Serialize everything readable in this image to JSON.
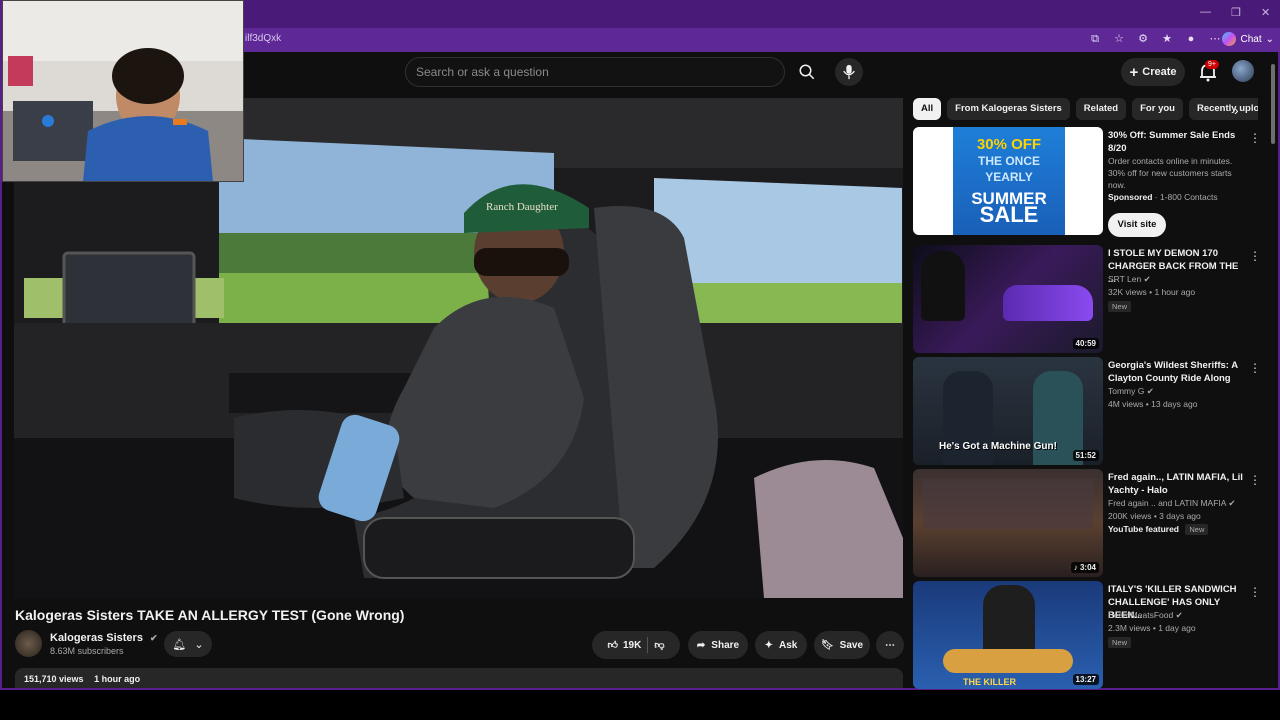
{
  "browser": {
    "url_fragment": "ilf3dQxk",
    "chat_label": "Chat"
  },
  "header": {
    "search_placeholder": "Search or ask a question",
    "create_label": "Create",
    "notif_badge": "9+"
  },
  "video": {
    "title": "Kalogeras Sisters TAKE AN ALLERGY TEST (Gone Wrong)",
    "channel": "Kalogeras Sisters",
    "subscribers": "8.63M subscribers",
    "likes": "19K",
    "share_label": "Share",
    "ask_label": "Ask",
    "save_label": "Save",
    "views": "151,710 views",
    "age": "1 hour ago",
    "hat_text": "Ranch Daughter"
  },
  "chips": [
    "All",
    "From Kalogeras Sisters",
    "Related",
    "For you",
    "Recently uploaded"
  ],
  "ad": {
    "title": "30% Off: Summer Sale Ends 8/20",
    "desc": "Order contacts online in minutes. 30% off for new customers starts now.",
    "sponsored": "Sponsored",
    "advertiser": "1-800 Contacts",
    "cta": "Visit site",
    "thumb_line1": "30% OFF",
    "thumb_line2": "THE ONCE",
    "thumb_line3": "YEARLY",
    "thumb_line4": "SUMMER",
    "thumb_line5": "SALE"
  },
  "recs": [
    {
      "title": "I STOLE MY DEMON 170 CHARGER BACK FROM THE ...",
      "channel": "SRT Len",
      "meta": "32K views • 1 hour ago",
      "tag": "New",
      "duration": "40:59"
    },
    {
      "title": "Georgia's Wildest Sheriffs: A Clayton County Ride Along",
      "channel": "Tommy G",
      "meta": "4M views • 13 days ago",
      "tag": "",
      "duration": "51:52",
      "thumb_caption": "He's Got a Machine Gun!"
    },
    {
      "title": "Fred again.., LATIN MAFIA, Lil Yachty - Halo",
      "channel": "Fred again .. and LATIN MAFIA",
      "meta": "200K views • 3 days ago",
      "tag": "YouTube featured",
      "tag2": "New",
      "duration": "3:04"
    },
    {
      "title": "ITALY'S 'KILLER SANDWICH CHALLENGE' HAS ONLY BEEN...",
      "channel": "BeardMeatsFood",
      "meta": "2.3M views • 1 day ago",
      "tag": "New",
      "duration": "13:27",
      "thumb_caption": "THE KILLER"
    }
  ],
  "colors": {
    "frame": "#5a1e8a",
    "bg": "#0f0f0f",
    "pill": "#272727",
    "badge": "#cc0000"
  }
}
